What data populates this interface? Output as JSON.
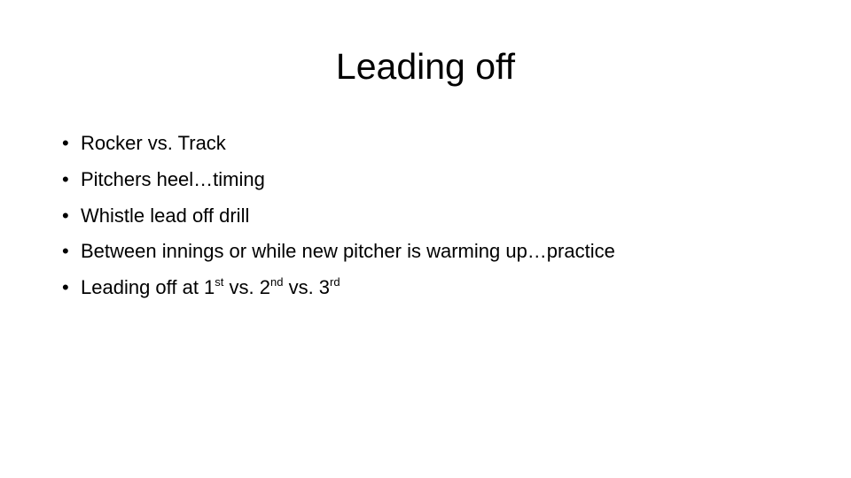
{
  "slide": {
    "title": "Leading off",
    "bullet_glyph": "•",
    "bullets": [
      {
        "text": "Rocker vs. Track"
      },
      {
        "text": "Pitchers heel…timing"
      },
      {
        "text": "Whistle lead off drill"
      },
      {
        "text": "Between innings or while new pitcher is warming up…practice"
      },
      {
        "parts": {
          "a": "Leading off at 1",
          "a_sup": "st",
          "b": " vs. 2",
          "b_sup": "nd",
          "c": " vs. 3",
          "c_sup": "rd"
        }
      }
    ]
  }
}
